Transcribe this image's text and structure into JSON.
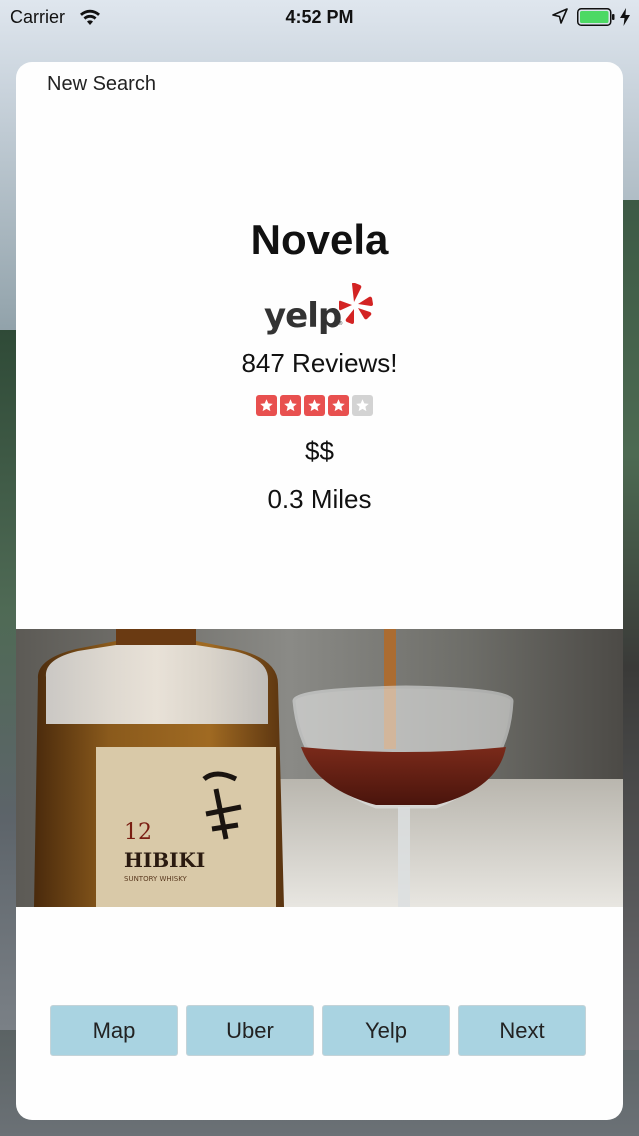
{
  "status_bar": {
    "carrier": "Carrier",
    "time": "4:52 PM"
  },
  "header": {
    "new_search_label": "New Search"
  },
  "business": {
    "name": "Novela",
    "source_logo": "yelp",
    "reviews_text": "847 Reviews!",
    "rating": 4,
    "rating_max": 5,
    "price": "$$",
    "distance": "0.3 Miles"
  },
  "photo": {
    "bottle_label_number": "12",
    "bottle_label_name": "HIBIKI",
    "bottle_label_sub": "SUNTORY WHISKY"
  },
  "actions": [
    {
      "label": "Map"
    },
    {
      "label": "Uber"
    },
    {
      "label": "Yelp"
    },
    {
      "label": "Next"
    }
  ],
  "colors": {
    "star_filled": "#e8504f",
    "star_empty": "#d3d3d3",
    "button_bg": "#a9d3e1",
    "yelp_red": "#d32323",
    "battery_green": "#4cd964"
  }
}
